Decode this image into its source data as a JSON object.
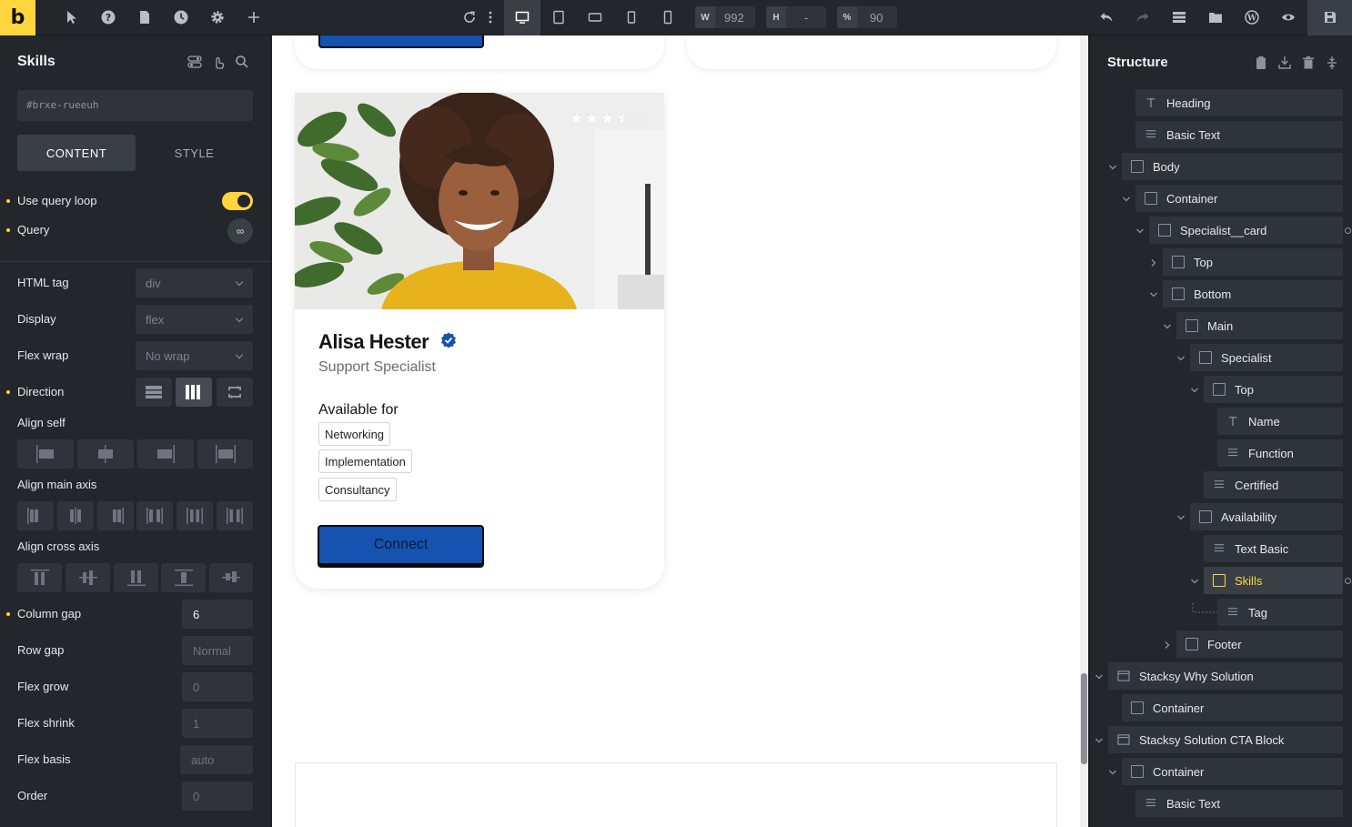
{
  "toolbar": {
    "logo": "b",
    "width_key": "W",
    "width_value": "992",
    "height_key": "H",
    "height_value": "-",
    "zoom_key": "%",
    "zoom_value": "90",
    "icons": [
      "cursor-icon",
      "help-icon",
      "pages-icon",
      "history-icon",
      "settings-icon",
      "add-icon",
      "reload-icon",
      "more-icon",
      "desktop-icon",
      "tablet-landscape-icon",
      "tablet-portrait-icon",
      "mobile-landscape-icon",
      "mobile-portrait-icon",
      "undo-icon",
      "redo-icon",
      "structure-icon",
      "folder-icon",
      "wordpress-icon",
      "preview-icon",
      "save-icon"
    ]
  },
  "left_panel": {
    "title": "Skills",
    "element_id": "#brxe-rueeuh",
    "tabs": {
      "content": "CONTENT",
      "style": "STYLE"
    },
    "use_query_loop": "Use query loop",
    "query": "Query",
    "query_icon": "∞",
    "html_tag": {
      "label": "HTML tag",
      "value": "div"
    },
    "display": {
      "label": "Display",
      "value": "flex"
    },
    "flex_wrap": {
      "label": "Flex wrap",
      "value": "No wrap"
    },
    "direction": "Direction",
    "align_self": "Align self",
    "align_main_axis": "Align main axis",
    "align_cross_axis": "Align cross axis",
    "column_gap": {
      "label": "Column gap",
      "value": "6"
    },
    "row_gap": {
      "label": "Row gap",
      "placeholder": "Normal"
    },
    "flex_grow": {
      "label": "Flex grow",
      "placeholder": "0"
    },
    "flex_shrink": {
      "label": "Flex shrink",
      "placeholder": "1"
    },
    "flex_basis": {
      "label": "Flex basis",
      "placeholder": "auto"
    },
    "order": {
      "label": "Order",
      "placeholder": "0"
    }
  },
  "card": {
    "rating": "3.5",
    "stars": "★★★⯪☆",
    "name": "Alisa Hester",
    "role": "Support Specialist",
    "available_for": "Available for",
    "tags": [
      "Networking",
      "Implementation",
      "Consultancy"
    ],
    "button": "Connect"
  },
  "structure": {
    "title": "Structure",
    "nodes": [
      {
        "label": "Heading"
      },
      {
        "label": "Basic Text"
      },
      {
        "label": "Body"
      },
      {
        "label": "Container"
      },
      {
        "label": "Specialist__card"
      },
      {
        "label": "Top"
      },
      {
        "label": "Bottom"
      },
      {
        "label": "Main"
      },
      {
        "label": "Specialist"
      },
      {
        "label": "Top"
      },
      {
        "label": "Name"
      },
      {
        "label": "Function"
      },
      {
        "label": "Certified"
      },
      {
        "label": "Availability"
      },
      {
        "label": "Text Basic"
      },
      {
        "label": "Skills"
      },
      {
        "label": "Tag"
      },
      {
        "label": "Footer"
      },
      {
        "label": "Stacksy Why Solution"
      },
      {
        "label": "Container"
      },
      {
        "label": "Stacksy Solution CTA Block"
      },
      {
        "label": "Container"
      },
      {
        "label": "Basic Text"
      }
    ]
  },
  "colors": {
    "accent": "#ffd53e",
    "button_blue": "#1652b0",
    "panel_bg": "#23262b"
  }
}
